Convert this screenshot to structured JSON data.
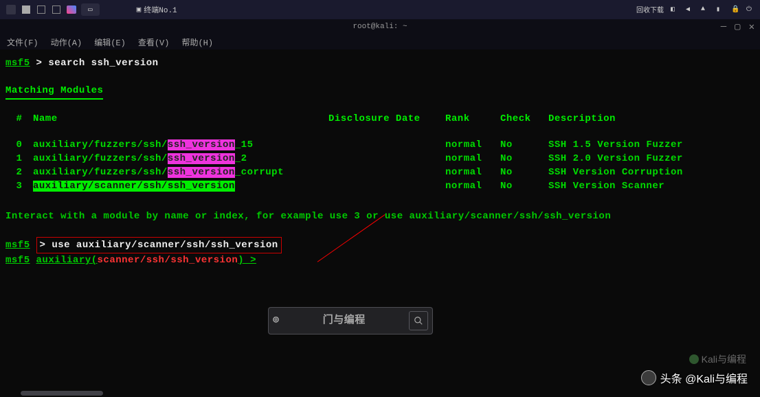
{
  "taskbar": {
    "active_title": "终端No.1",
    "window_title": "终端No.1",
    "tray_text": "回收下载"
  },
  "window": {
    "title": "root@kali: ~"
  },
  "menu": {
    "items": [
      "文件(F)",
      "动作(A)",
      "编辑(E)",
      "查看(V)",
      "帮助(H)"
    ]
  },
  "terminal": {
    "prompt1_label": "msf5",
    "prompt1_cmd": "search ssh_version",
    "matching_header": "Matching Modules",
    "columns": {
      "idx": "#",
      "name": "Name",
      "date": "Disclosure Date",
      "rank": "Rank",
      "check": "Check",
      "desc": "Description"
    },
    "rows": [
      {
        "idx": "0",
        "prefix": "auxiliary/fuzzers/ssh/",
        "hl": "ssh_version",
        "hl_class": "hl-magenta",
        "suffix": "_15",
        "rank": "normal",
        "check": "No",
        "desc": "SSH 1.5 Version Fuzzer"
      },
      {
        "idx": "1",
        "prefix": "auxiliary/fuzzers/ssh/",
        "hl": "ssh_version",
        "hl_class": "hl-magenta",
        "suffix": "_2",
        "rank": "normal",
        "check": "No",
        "desc": "SSH 2.0 Version Fuzzer"
      },
      {
        "idx": "2",
        "prefix": "auxiliary/fuzzers/ssh/",
        "hl": "ssh_version",
        "hl_class": "hl-magenta",
        "suffix": "_corrupt",
        "rank": "normal",
        "check": "No",
        "desc": "SSH Version Corruption"
      },
      {
        "idx": "3",
        "prefix": "auxiliary/scanner/ssh/",
        "hl": "ssh_version",
        "hl_class": "hl-green",
        "suffix": "",
        "row_hl": true,
        "rank": "normal",
        "check": "No",
        "desc": "SSH Version Scanner"
      }
    ],
    "interact_hint": "Interact with a module by name or index, for example use 3 or use auxiliary/scanner/ssh/ssh_version",
    "prompt2_label": "msf5",
    "prompt2_cmd": "use auxiliary/scanner/ssh/ssh_version",
    "prompt3_label": "msf5",
    "prompt3_aux": "auxiliary(",
    "prompt3_red": "scanner/ssh/ssh_version",
    "prompt3_close": ") > "
  },
  "search_overlay": {
    "text": "门与编程"
  },
  "watermarks": {
    "wm1": "头条 @Kali与编程",
    "wm2": "Kali与编程"
  }
}
